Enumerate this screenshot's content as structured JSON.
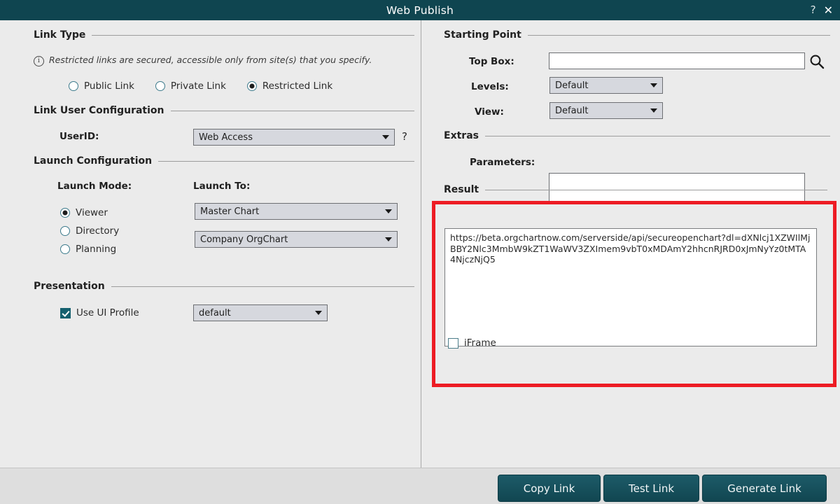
{
  "window": {
    "title": "Web Publish",
    "help_label": "?",
    "close_label": "✕"
  },
  "left": {
    "link_type": {
      "section_title": "Link Type",
      "note": "Restricted links are secured, accessible only from site(s) that you specify.",
      "info_icon_glyph": "i",
      "options": [
        {
          "label": "Public Link",
          "selected": false
        },
        {
          "label": "Private Link",
          "selected": false
        },
        {
          "label": "Restricted Link",
          "selected": true
        }
      ]
    },
    "link_user_config": {
      "section_title": "Link User Configuration",
      "userid_label": "UserID:",
      "userid_value": "Web Access",
      "userid_help": "?"
    },
    "launch_config": {
      "section_title": "Launch Configuration",
      "launch_mode_label": "Launch Mode:",
      "launch_to_label": "Launch To:",
      "modes": [
        {
          "label": "Viewer",
          "selected": true
        },
        {
          "label": "Directory",
          "selected": false
        },
        {
          "label": "Planning",
          "selected": false
        }
      ],
      "launch_to_chart": "Master Chart",
      "launch_to_target": "Company OrgChart"
    },
    "presentation": {
      "section_title": "Presentation",
      "use_ui_profile_label": "Use UI Profile",
      "use_ui_profile_checked": true,
      "profile_value": "default"
    }
  },
  "right": {
    "starting_point": {
      "section_title": "Starting Point",
      "top_box_label": "Top Box:",
      "top_box_value": "",
      "search_icon": "search-icon",
      "levels_label": "Levels:",
      "levels_value": "Default",
      "view_label": "View:",
      "view_value": "Default"
    },
    "extras": {
      "section_title": "Extras",
      "parameters_label": "Parameters:",
      "parameters_value": ""
    },
    "result": {
      "section_title": "Result",
      "url": "https://beta.orgchartnow.com/serverside/api/secureopenchart?dl=dXNlcj1XZWIlMjBBY2Nlc3MmbW9kZT1WaWV3ZXImem9vbT0xMDAmY2hhcnRJRD0xJmNyYz0tMTA4NjczNjQ5",
      "iframe_label": "iFrame",
      "iframe_checked": false,
      "highlight_color": "#ed1c24"
    }
  },
  "footer": {
    "copy_link": "Copy Link",
    "test_link": "Test Link",
    "generate_link": "Generate Link"
  },
  "theme": {
    "titlebar_bg": "#0f4550",
    "window_bg": "#ebebeb",
    "button_bg": "#144c58",
    "accent": "#15606e"
  }
}
